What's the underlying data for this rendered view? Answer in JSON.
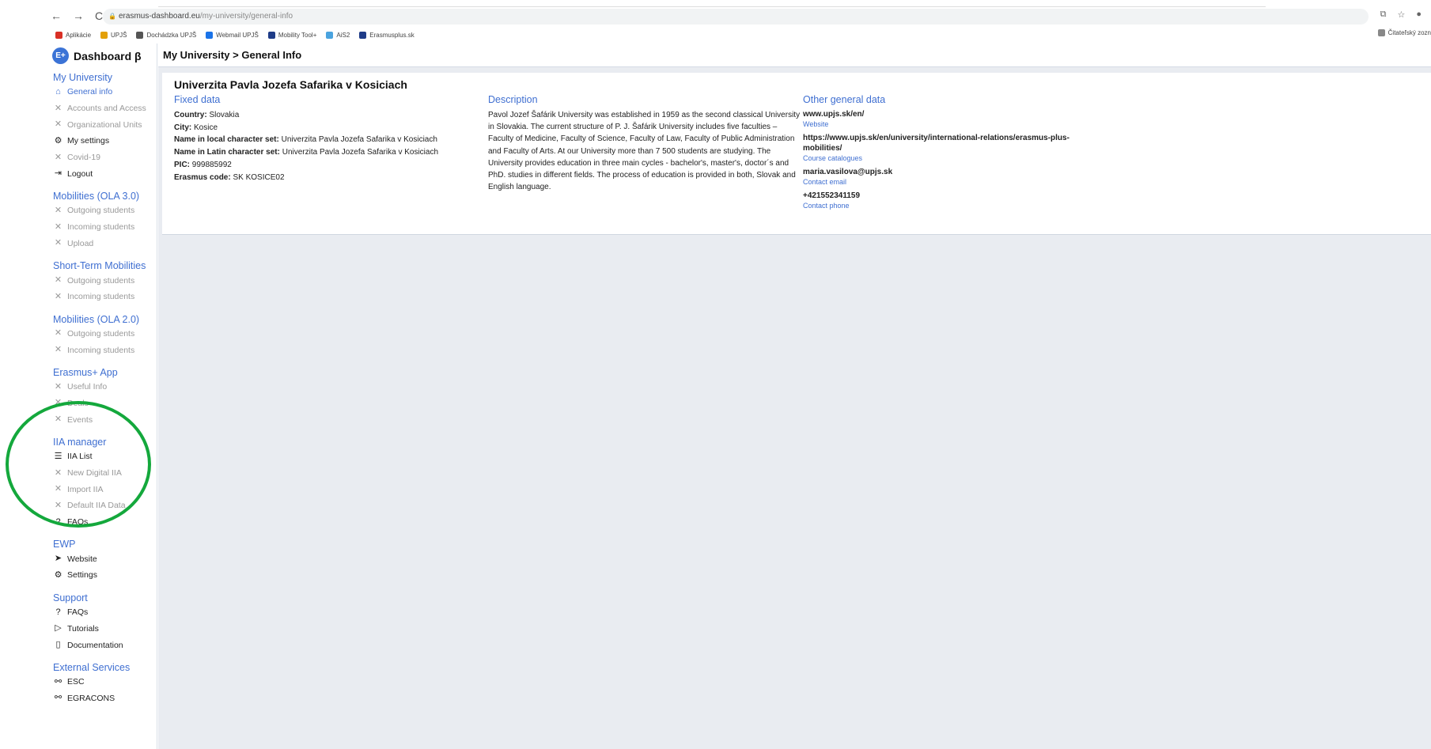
{
  "browser": {
    "nav": {
      "back": "←",
      "forward": "→",
      "reload": "C"
    },
    "url_host": "erasmus-dashboard.eu",
    "url_path": "/my-university/general-info",
    "bookmarks": [
      {
        "label": "Aplikácie",
        "color": "#d93025"
      },
      {
        "label": "UPJŠ",
        "color": "#e3a008"
      },
      {
        "label": "Dochádzka UPJŠ",
        "color": "#555555"
      },
      {
        "label": "Webmail UPJŠ",
        "color": "#1a73e8"
      },
      {
        "label": "Mobility Tool+",
        "color": "#1f3c88"
      },
      {
        "label": "AiS2",
        "color": "#4aa3df"
      },
      {
        "label": "Erasmusplus.sk",
        "color": "#1f3c88"
      }
    ],
    "reader_list": "Čitateľský zozn"
  },
  "app": {
    "brand_icon": "E+",
    "brand": "Dashboard β",
    "breadcrumb": "My University > General Info",
    "sidebar": [
      {
        "title": "My University",
        "items": [
          {
            "label": "General info",
            "icon": "⌂",
            "state": "active"
          },
          {
            "label": "Accounts and Access",
            "icon": "✕",
            "state": "disabled"
          },
          {
            "label": "Organizational Units",
            "icon": "✕",
            "state": "disabled"
          },
          {
            "label": "My settings",
            "icon": "⚙",
            "state": "enabled"
          },
          {
            "label": "Covid-19",
            "icon": "✕",
            "state": "disabled"
          },
          {
            "label": "Logout",
            "icon": "⇥",
            "state": "enabled"
          }
        ]
      },
      {
        "title": "Mobilities (OLA 3.0)",
        "items": [
          {
            "label": "Outgoing students",
            "icon": "✕",
            "state": "disabled"
          },
          {
            "label": "Incoming students",
            "icon": "✕",
            "state": "disabled"
          },
          {
            "label": "Upload",
            "icon": "✕",
            "state": "disabled"
          }
        ]
      },
      {
        "title": "Short-Term Mobilities",
        "items": [
          {
            "label": "Outgoing students",
            "icon": "✕",
            "state": "disabled"
          },
          {
            "label": "Incoming students",
            "icon": "✕",
            "state": "disabled"
          }
        ]
      },
      {
        "title": "Mobilities (OLA 2.0)",
        "items": [
          {
            "label": "Outgoing students",
            "icon": "✕",
            "state": "disabled"
          },
          {
            "label": "Incoming students",
            "icon": "✕",
            "state": "disabled"
          }
        ]
      },
      {
        "title": "Erasmus+ App",
        "items": [
          {
            "label": "Useful Info",
            "icon": "✕",
            "state": "disabled"
          },
          {
            "label": "Deals",
            "icon": "✕",
            "state": "disabled"
          },
          {
            "label": "Events",
            "icon": "✕",
            "state": "disabled"
          }
        ]
      },
      {
        "title": "IIA manager",
        "items": [
          {
            "label": "IIA List",
            "icon": "☰",
            "state": "enabled"
          },
          {
            "label": "New Digital IIA",
            "icon": "✕",
            "state": "disabled"
          },
          {
            "label": "Import IIA",
            "icon": "✕",
            "state": "disabled"
          },
          {
            "label": "Default IIA Data",
            "icon": "✕",
            "state": "disabled"
          },
          {
            "label": "FAQs",
            "icon": "?",
            "state": "enabled"
          }
        ]
      },
      {
        "title": "EWP",
        "items": [
          {
            "label": "Website",
            "icon": "➤",
            "state": "enabled"
          },
          {
            "label": "Settings",
            "icon": "⚙",
            "state": "enabled"
          }
        ]
      },
      {
        "title": "Support",
        "items": [
          {
            "label": "FAQs",
            "icon": "?",
            "state": "enabled"
          },
          {
            "label": "Tutorials",
            "icon": "▷",
            "state": "enabled"
          },
          {
            "label": "Documentation",
            "icon": "▯",
            "state": "enabled"
          }
        ]
      },
      {
        "title": "External Services",
        "items": [
          {
            "label": "ESC",
            "icon": "⚯",
            "state": "enabled"
          },
          {
            "label": "EGRACONS",
            "icon": "⚯",
            "state": "enabled"
          }
        ]
      }
    ],
    "university": "Univerzita Pavla Jozefa Safarika v Kosiciach",
    "fixed": {
      "title": "Fixed data",
      "rows": [
        {
          "k": "Country:",
          "v": "Slovakia"
        },
        {
          "k": "City:",
          "v": "Kosice"
        },
        {
          "k": "Name in local character set:",
          "v": "Univerzita Pavla Jozefa Safarika v Kosiciach"
        },
        {
          "k": "Name in Latin character set:",
          "v": "Univerzita Pavla Jozefa Safarika v Kosiciach"
        },
        {
          "k": "PIC:",
          "v": "999885992"
        },
        {
          "k": "Erasmus code:",
          "v": "SK KOSICE02"
        }
      ]
    },
    "description": {
      "title": "Description",
      "text": "Pavol Jozef Šafárik University was established in 1959 as the second classical University in Slovakia. The current structure of P. J. Šafárik University includes five faculties – Faculty of Medicine, Faculty of Science, Faculty of Law, Faculty of Public Administration and Faculty of Arts. At our University more than 7 500 students are studying. The University provides education in three main cycles - bachelor's, master's, doctor´s and PhD. studies in different fields. The process of education is provided in both, Slovak and English language."
    },
    "other": {
      "title": "Other general data",
      "entries": [
        {
          "value": "www.upjs.sk/en/",
          "label": "Website"
        },
        {
          "value": "https://www.upjs.sk/en/university/international-relations/erasmus-plus-mobilities/",
          "label": "Course catalogues"
        },
        {
          "value": "maria.vasilova@upjs.sk",
          "label": "Contact email"
        },
        {
          "value": "+421552341159",
          "label": "Contact phone"
        }
      ]
    }
  }
}
